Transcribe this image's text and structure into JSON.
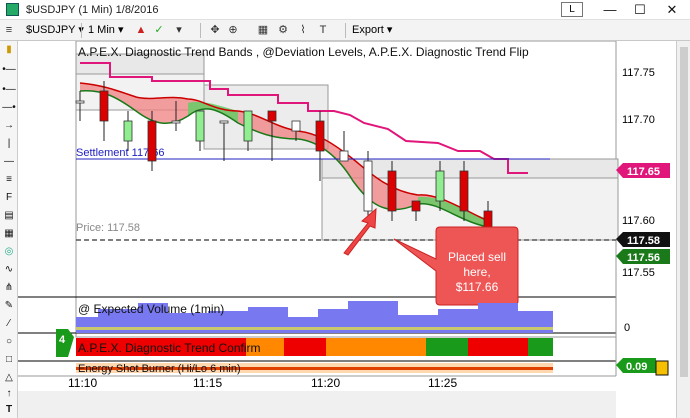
{
  "window": {
    "title": "$USDJPY (1 Min)  1/8/2016",
    "link_badge": "L",
    "minimize": "—",
    "maximize": "☐",
    "close": "✕"
  },
  "toolbar": {
    "symbol": "$USDJPY",
    "interval": "1 Min",
    "export_label": "Export"
  },
  "chart": {
    "study_title": "A.P.E.X. Diagnostic Trend Bands , @Deviation Levels, A.P.E.X. Diagnostic Trend Flip",
    "settlement_label": "Settlement 117.66",
    "price_label": "Price: 117.58",
    "price_axis_ticks": [
      "117.75",
      "117.70",
      "117.60",
      "117.55"
    ],
    "price_badges": {
      "upper": "117.65",
      "current": "117.58",
      "low": "117.56"
    },
    "callout_text": [
      "Placed sell",
      "here,",
      "$117.66"
    ],
    "volume_panel_label": "@ Expected Volume (1min)",
    "volume_zero": "0",
    "confirm_panel_label": "A.P.E.X. Diagnostic Trend Confirm",
    "confirm_badge": "4",
    "bottom_panel_label": "Energy Shot Burner (Hi/Lo 6 min)",
    "bottom_badge": "0.09",
    "time_axis_ticks": [
      "11:10",
      "11:15",
      "11:20",
      "11:25"
    ],
    "colors": {
      "up_candle": "#90ee90",
      "down_candle": "#dd0000",
      "resistance_line": "#e0167a",
      "settlement_line": "#2020c0",
      "callout_fill": "#ee4444",
      "volume_fill": "#7878f0"
    }
  },
  "chart_data": {
    "type": "candlestick",
    "title": "A.P.E.X. Diagnostic Trend Bands , @Deviation Levels, A.P.E.X. Diagnostic Trend Flip",
    "ylim": [
      117.53,
      117.78
    ],
    "x": [
      "11:10",
      "11:11",
      "11:12",
      "11:13",
      "11:14",
      "11:15",
      "11:16",
      "11:17",
      "11:18",
      "11:19",
      "11:20",
      "11:21",
      "11:22",
      "11:23",
      "11:24",
      "11:25",
      "11:26",
      "11:27",
      "11:28"
    ],
    "candles": [
      {
        "o": 117.72,
        "h": 117.73,
        "l": 117.7,
        "c": 117.72,
        "dir": "flat"
      },
      {
        "o": 117.73,
        "h": 117.74,
        "l": 117.68,
        "c": 117.7,
        "dir": "down"
      },
      {
        "o": 117.68,
        "h": 117.71,
        "l": 117.67,
        "c": 117.7,
        "dir": "up"
      },
      {
        "o": 117.7,
        "h": 117.71,
        "l": 117.65,
        "c": 117.66,
        "dir": "down"
      },
      {
        "o": 117.7,
        "h": 117.72,
        "l": 117.69,
        "c": 117.7,
        "dir": "flat"
      },
      {
        "o": 117.68,
        "h": 117.71,
        "l": 117.67,
        "c": 117.71,
        "dir": "up"
      },
      {
        "o": 117.7,
        "h": 117.7,
        "l": 117.66,
        "c": 117.7,
        "dir": "flat"
      },
      {
        "o": 117.68,
        "h": 117.71,
        "l": 117.67,
        "c": 117.71,
        "dir": "up"
      },
      {
        "o": 117.71,
        "h": 117.71,
        "l": 117.66,
        "c": 117.7,
        "dir": "down"
      },
      {
        "o": 117.7,
        "h": 117.7,
        "l": 117.68,
        "c": 117.69,
        "dir": "flat"
      },
      {
        "o": 117.7,
        "h": 117.71,
        "l": 117.64,
        "c": 117.67,
        "dir": "down"
      },
      {
        "o": 117.67,
        "h": 117.69,
        "l": 117.66,
        "c": 117.66,
        "dir": "flat"
      },
      {
        "o": 117.66,
        "h": 117.67,
        "l": 117.6,
        "c": 117.61,
        "dir": "flat"
      },
      {
        "o": 117.65,
        "h": 117.66,
        "l": 117.6,
        "c": 117.61,
        "dir": "down"
      },
      {
        "o": 117.61,
        "h": 117.62,
        "l": 117.6,
        "c": 117.62,
        "dir": "down"
      },
      {
        "o": 117.62,
        "h": 117.66,
        "l": 117.61,
        "c": 117.65,
        "dir": "up"
      },
      {
        "o": 117.65,
        "h": 117.66,
        "l": 117.6,
        "c": 117.61,
        "dir": "down"
      },
      {
        "o": 117.61,
        "h": 117.62,
        "l": 117.58,
        "c": 117.58,
        "dir": "down"
      },
      {
        "o": 117.56,
        "h": 117.58,
        "l": 117.55,
        "c": 117.58,
        "dir": "up"
      }
    ],
    "settlement": 117.66,
    "price": 117.58
  }
}
